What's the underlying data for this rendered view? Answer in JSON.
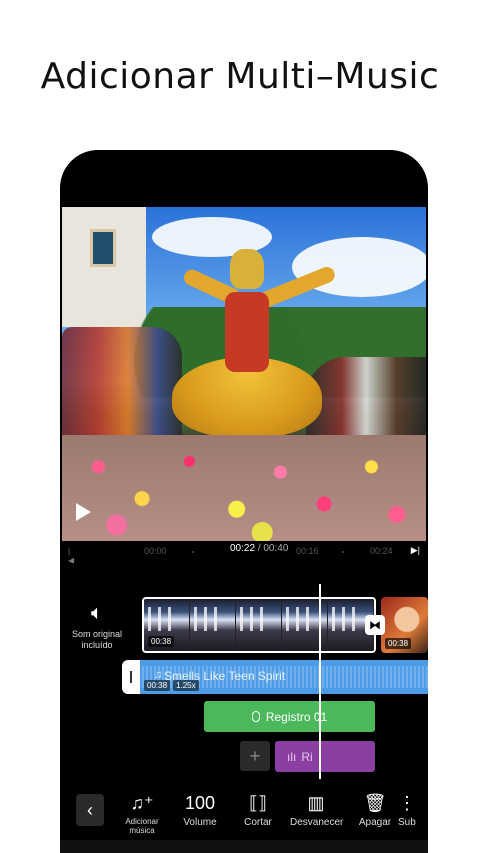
{
  "headline": "Adicionar Multi–Music",
  "timeline": {
    "ruler": {
      "ticks": [
        "00:00",
        "00:16",
        "00:24"
      ],
      "current_time": "00:22",
      "total_time": "/ 00:40"
    },
    "original_sound": {
      "icon": "speaker-icon",
      "label": "Som original incluído"
    },
    "video_clip": {
      "duration": "00:38"
    },
    "video_clip_2": {
      "duration": "00:38"
    },
    "music": {
      "title": "Smells Like Teen Spirit",
      "start": "00:38",
      "speed": "1.25x"
    },
    "record": {
      "label": "Registro 01"
    },
    "purple_track": {
      "label": "Ri"
    },
    "add_symbol": "+"
  },
  "toolbar": {
    "back": "‹",
    "items": [
      {
        "label": "Adicionar música",
        "icon": "music-add-icon"
      },
      {
        "value": "100",
        "label": "Volume"
      },
      {
        "label": "Cortar",
        "icon": "trim-icon"
      },
      {
        "label": "Desvanecer",
        "icon": "fade-icon"
      },
      {
        "label": "Apagar",
        "icon": "trash-icon"
      },
      {
        "label": "Sub",
        "icon": "more-icon"
      }
    ]
  },
  "colors": {
    "music_track": "#4d9ce8",
    "record_track": "#4cb85c",
    "purple_track": "#8b3fa3"
  }
}
